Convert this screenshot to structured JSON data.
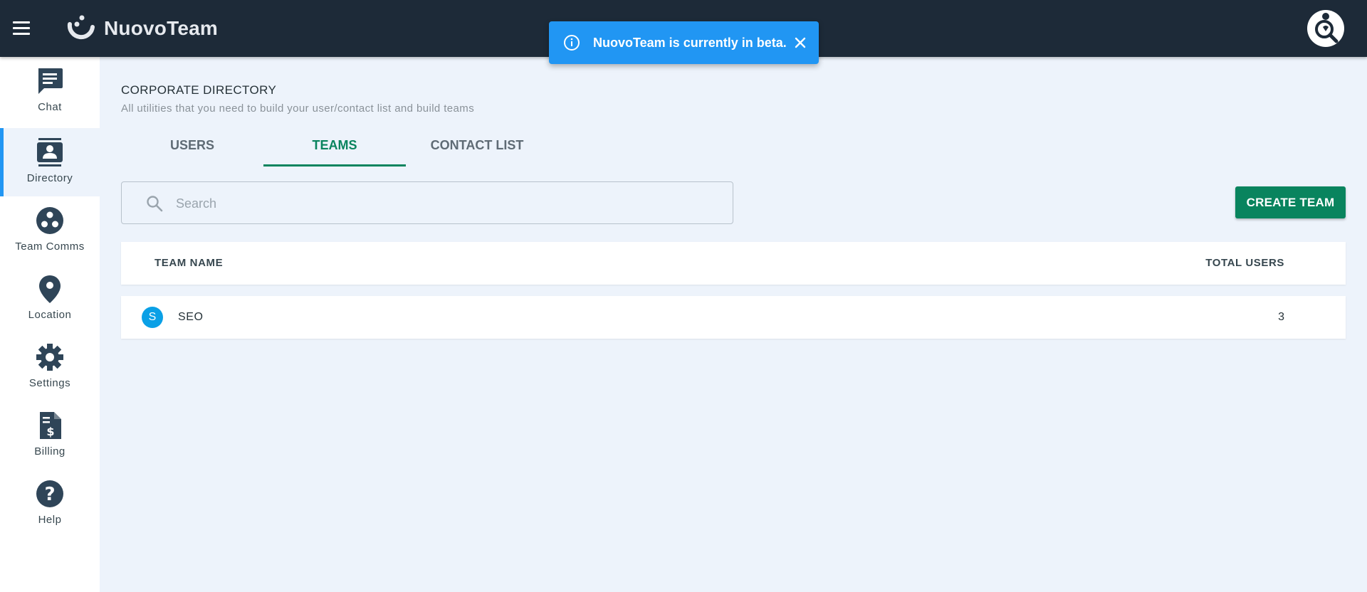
{
  "app": {
    "name": "NuovoTeam"
  },
  "toast": {
    "message": "NuovoTeam is currently in beta."
  },
  "sidebar": {
    "items": [
      {
        "label": "Chat",
        "icon": "chat-icon"
      },
      {
        "label": "Directory",
        "icon": "directory-icon",
        "active": true
      },
      {
        "label": "Team Comms",
        "icon": "team-comms-icon"
      },
      {
        "label": "Location",
        "icon": "location-pin-icon"
      },
      {
        "label": "Settings",
        "icon": "gear-icon"
      },
      {
        "label": "Billing",
        "icon": "billing-icon"
      },
      {
        "label": "Help",
        "icon": "help-icon"
      }
    ]
  },
  "page": {
    "title": "CORPORATE DIRECTORY",
    "subtitle": "All utilities that you need to build your user/contact list and build teams"
  },
  "tabs": [
    {
      "label": "USERS"
    },
    {
      "label": "TEAMS",
      "active": true
    },
    {
      "label": "CONTACT LIST"
    }
  ],
  "search": {
    "placeholder": "Search",
    "value": ""
  },
  "actions": {
    "create_team": "CREATE TEAM"
  },
  "table": {
    "columns": [
      "TEAM NAME",
      "TOTAL USERS"
    ],
    "rows": [
      {
        "initial": "S",
        "name": "SEO",
        "total_users": "3"
      }
    ]
  },
  "colors": {
    "topbar": "#1d2a38",
    "accent_green": "#09845e",
    "toast_blue": "#2196f3",
    "active_indicator": "#2196f3",
    "avatar_blue": "#0aa0e6",
    "page_bg": "#edf3fb"
  }
}
